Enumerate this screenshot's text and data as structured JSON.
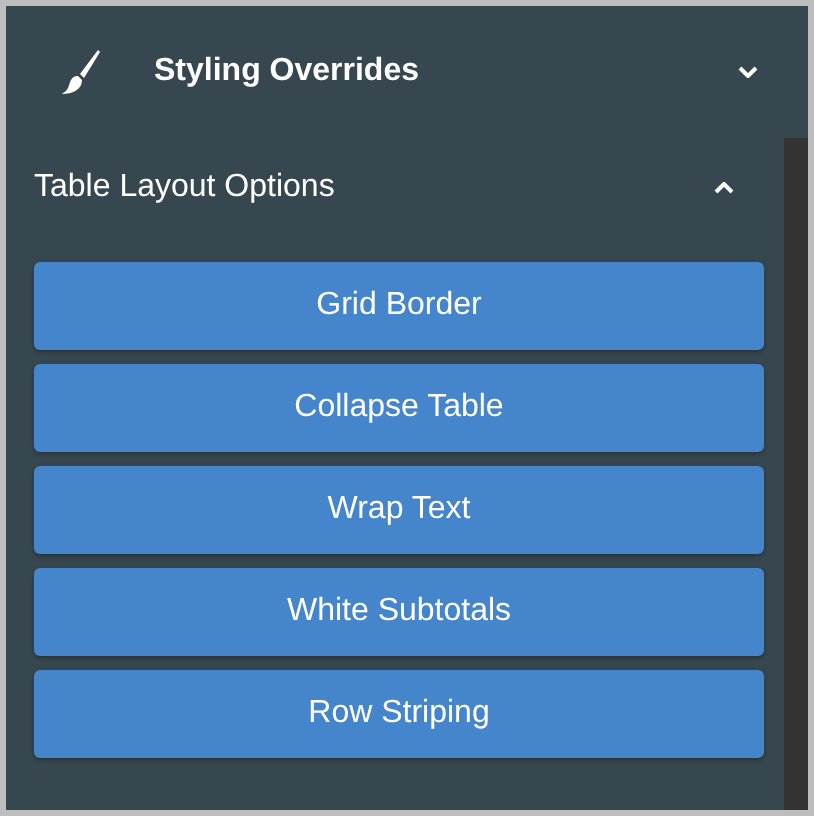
{
  "panel": {
    "title": "Styling Overrides",
    "expanded": false
  },
  "section": {
    "title": "Table Layout Options",
    "expanded": true
  },
  "buttons": [
    "Grid Border",
    "Collapse Table",
    "Wrap Text",
    "White Subtotals",
    "Row Striping"
  ]
}
